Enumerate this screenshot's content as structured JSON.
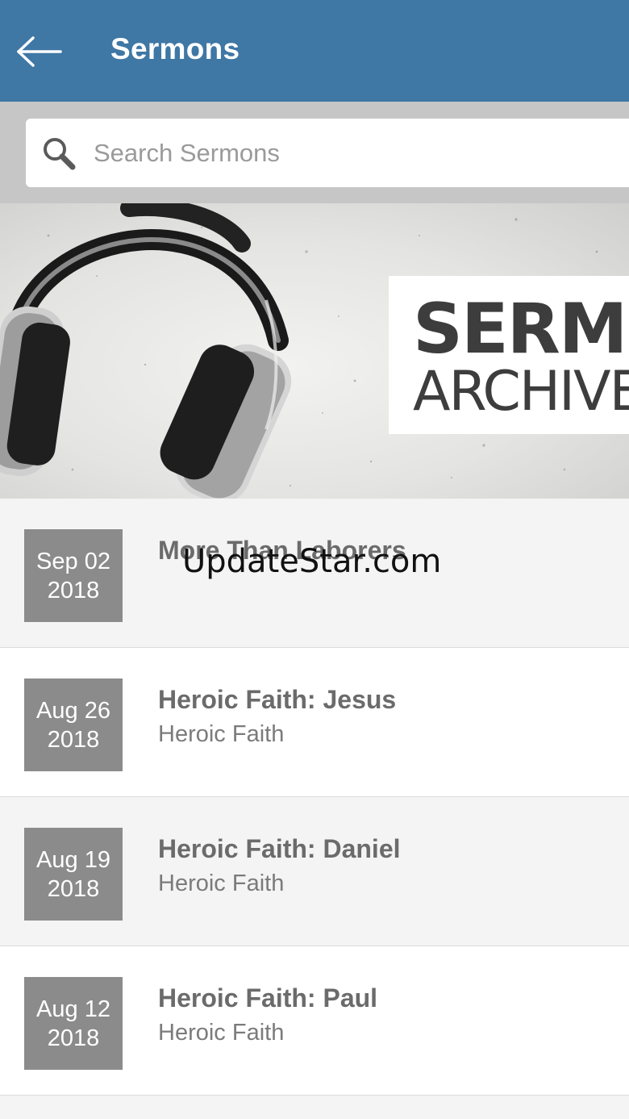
{
  "header": {
    "title": "Sermons",
    "back_icon": "arrow-left-icon",
    "background": "#3f77a5"
  },
  "search": {
    "placeholder": "Search Sermons",
    "value": "",
    "icon": "search-icon"
  },
  "banner": {
    "line1": "SERMO",
    "line2": "ARCHIVE",
    "image": "headphones"
  },
  "sermons": [
    {
      "month_day": "Sep 02",
      "year": "2018",
      "title": "More Than Laborers",
      "series": ""
    },
    {
      "month_day": "Aug 26",
      "year": "2018",
      "title": "Heroic Faith: Jesus",
      "series": "Heroic Faith"
    },
    {
      "month_day": "Aug 19",
      "year": "2018",
      "title": "Heroic Faith: Daniel",
      "series": "Heroic Faith"
    },
    {
      "month_day": "Aug 12",
      "year": "2018",
      "title": "Heroic Faith: Paul",
      "series": "Heroic Faith"
    }
  ],
  "watermark": "UpdateStar.com",
  "colors": {
    "date_box": "#8b8b8b",
    "row_shaded": "#f4f4f4",
    "search_strip": "#c6c6c6"
  }
}
